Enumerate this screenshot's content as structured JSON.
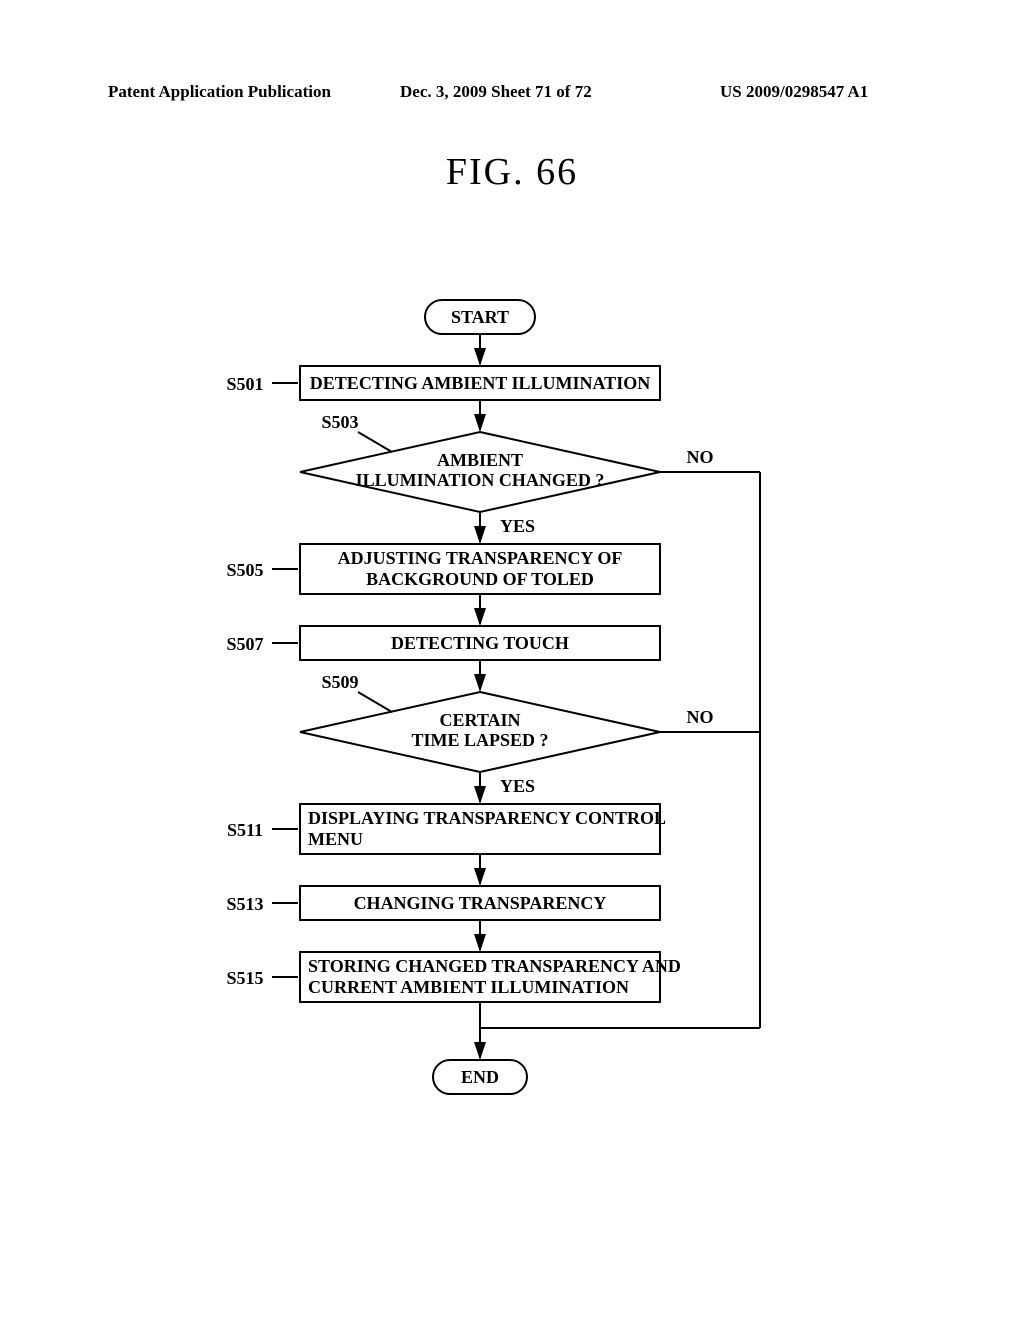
{
  "header": {
    "left": "Patent Application Publication",
    "mid": "Dec. 3, 2009  Sheet 71 of 72",
    "right": "US 2009/0298547 A1"
  },
  "figure_title": "FIG.  66",
  "labels": {
    "s501": "S501",
    "s503": "S503",
    "s505": "S505",
    "s507": "S507",
    "s509": "S509",
    "s511": "S511",
    "s513": "S513",
    "s515": "S515"
  },
  "flow": {
    "start": "START",
    "end": "END",
    "s501": "DETECTING AMBIENT ILLUMINATION",
    "s503_l1": "AMBIENT",
    "s503_l2": "ILLUMINATION CHANGED ?",
    "s505_l1": "ADJUSTING TRANSPARENCY OF",
    "s505_l2": "BACKGROUND OF TOLED",
    "s507": "DETECTING TOUCH",
    "s509_l1": "CERTAIN",
    "s509_l2": "TIME LAPSED ?",
    "s511_l1": "DISPLAYING TRANSPARENCY CONTROL",
    "s511_l2": "MENU",
    "s513": "CHANGING TRANSPARENCY",
    "s515_l1": "STORING CHANGED TRANSPARENCY AND",
    "s515_l2": "CURRENT AMBIENT ILLUMINATION",
    "yes": "YES",
    "no": "NO"
  }
}
